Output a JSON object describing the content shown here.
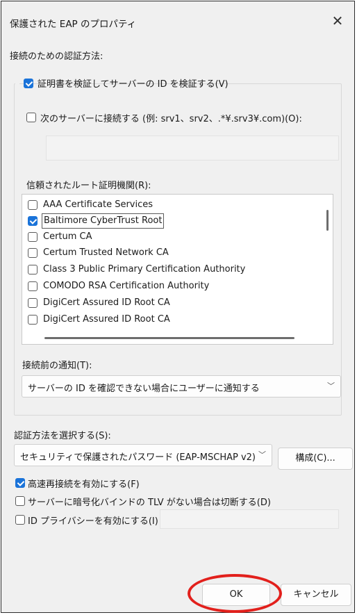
{
  "window": {
    "title": "保護された EAP のプロパティ",
    "close_glyph": "✕"
  },
  "auth_section": {
    "heading": "接続のための認証方法:",
    "verify_cert": {
      "label": "証明書を検証してサーバーの ID を検証する(V)",
      "checked": true
    },
    "connect_servers": {
      "label": "次のサーバーに接続する (例: srv1、srv2、.*¥.srv3¥.com)(O):",
      "checked": false,
      "value": ""
    },
    "trusted_ca": {
      "label": "信頼されたルート証明機関(R):",
      "items": [
        {
          "label": "AAA Certificate Services",
          "checked": false
        },
        {
          "label": "Baltimore CyberTrust Root",
          "checked": true
        },
        {
          "label": "Certum CA",
          "checked": false
        },
        {
          "label": "Certum Trusted Network CA",
          "checked": false
        },
        {
          "label": "Class 3 Public Primary Certification Authority",
          "checked": false
        },
        {
          "label": "COMODO RSA Certification Authority",
          "checked": false
        },
        {
          "label": "DigiCert Assured ID Root CA",
          "checked": false
        },
        {
          "label": "DigiCert Assured ID Root CA",
          "checked": false
        }
      ]
    },
    "notify": {
      "label": "接続前の通知(T):",
      "selected": "サーバーの ID を確認できない場合にユーザーに通知する"
    }
  },
  "method_section": {
    "label": "認証方法を選択する(S):",
    "selected": "セキュリティで保護されたパスワード (EAP-MSCHAP v2)",
    "configure_button": "構成(C)..."
  },
  "options": {
    "fast_reconnect": {
      "label": "高速再接続を有効にする(F)",
      "checked": true
    },
    "disconnect_tlv": {
      "label": "サーバーに暗号化バインドの TLV がない場合は切断する(D)",
      "checked": false
    },
    "id_privacy": {
      "label": "ID プライバシーを有効にする(I)",
      "checked": false,
      "value": ""
    }
  },
  "footer": {
    "ok_label": "OK",
    "cancel_label": "キャンセル",
    "highlight_color": "#e2201c"
  }
}
